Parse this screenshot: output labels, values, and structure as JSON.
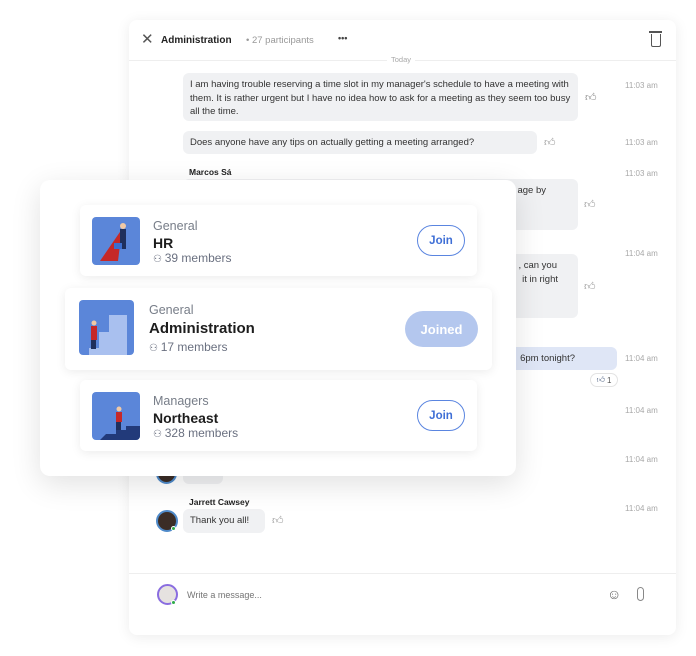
{
  "header": {
    "title": "Administration",
    "participants": "• 27 participants",
    "more": "•••"
  },
  "divider": "Today",
  "messages": [
    {
      "text": "I am having trouble reserving a time slot in my manager's schedule to have a meeting with them. It is rather urgent but I have no idea how to ask for a meeting as they seem too busy all the time.",
      "time": "11:03 am"
    },
    {
      "text": "Does anyone have any tips on actually getting a meeting arranged?",
      "time": "11:03 am"
    },
    {
      "sender": "Marcos Sá",
      "text": "age by",
      "time": "11:03 am"
    },
    {
      "text_line1": ", can you",
      "text_line2": "it in right",
      "time": "11:04 am"
    },
    {
      "text": "6pm tonight?",
      "time": "11:04 am",
      "reaction_count": "1"
    },
    {
      "time": "11:04 am"
    },
    {
      "time": "11:04 am"
    },
    {
      "sender": "Jarrett Cawsey",
      "text": "Thank you all!",
      "time": "11:04 am"
    }
  ],
  "composer": {
    "placeholder": "Write a message..."
  },
  "groups": [
    {
      "category": "General",
      "name": "HR",
      "members": "39 members",
      "button": "Join"
    },
    {
      "category": "General",
      "name": "Administration",
      "members": "17 members",
      "button": "Joined"
    },
    {
      "category": "Managers",
      "name": "Northeast",
      "members": "328 members",
      "button": "Join"
    }
  ],
  "colors": {
    "accent": "#3f6fd6",
    "joined": "#b4c7ee",
    "online": "#2eaa4a"
  }
}
